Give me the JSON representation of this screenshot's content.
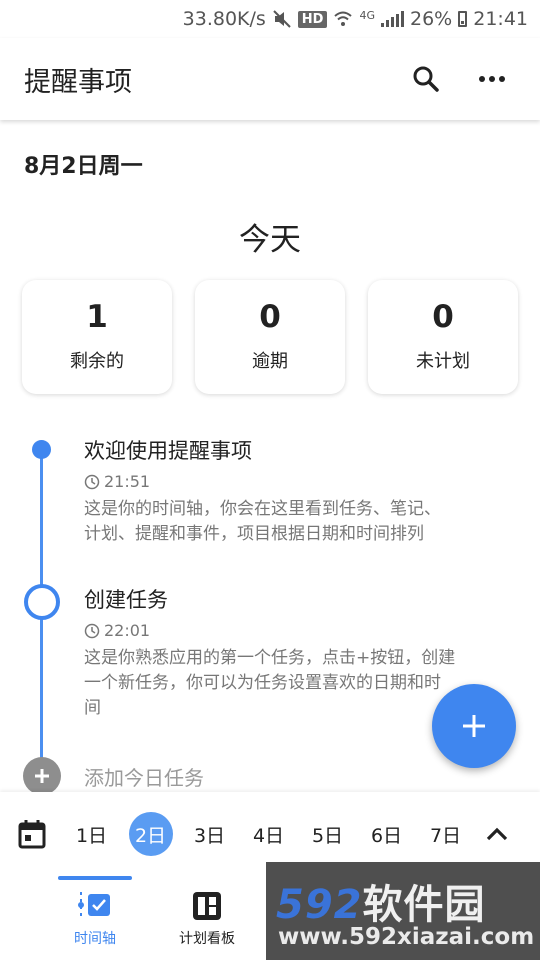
{
  "status_bar": {
    "speed": "33.80K/s",
    "hd": "HD",
    "network": "4G",
    "battery": "26%",
    "time": "21:41",
    "icons": [
      "mute-icon",
      "wifi-icon",
      "signal-icon",
      "battery-icon"
    ]
  },
  "app_bar": {
    "title": "提醒事项",
    "icons": [
      "search-icon",
      "more-icon"
    ]
  },
  "date_header": "8月2日周一",
  "today_label": "今天",
  "stats": [
    {
      "value": "1",
      "label": "剩余的"
    },
    {
      "value": "0",
      "label": "逾期"
    },
    {
      "value": "0",
      "label": "未计划"
    }
  ],
  "timeline": [
    {
      "title": "欢迎使用提醒事项",
      "time": "21:51",
      "desc_lines": [
        "这是你的时间轴，你会在这里看到任务、笔记、",
        "计划、提醒和事件，项目根据日期和时间排列"
      ]
    },
    {
      "title": "创建任务",
      "time": "22:01",
      "desc_lines": [
        "这是你熟悉应用的第一个任务，点击+按钮，创建",
        "一个新任务，你可以为任务设置喜欢的日期和时",
        "间"
      ]
    }
  ],
  "add_task_label": "添加今日任务",
  "colors": {
    "accent": "#3f86ef",
    "selected_day": "#5a9cf2",
    "muted_text": "#777777"
  },
  "day_strip": {
    "days": [
      "1日",
      "2日",
      "3日",
      "4日",
      "5日",
      "6日",
      "7日"
    ],
    "selected": "2日"
  },
  "bottom_nav": [
    {
      "label": "时间轴",
      "icon": "timeline-icon",
      "active": true
    },
    {
      "label": "计划看板",
      "icon": "board-icon",
      "active": false
    }
  ],
  "watermark": {
    "logo_digits": "592",
    "logo_cn": "软件园",
    "url": "www.592xiazai.com"
  }
}
